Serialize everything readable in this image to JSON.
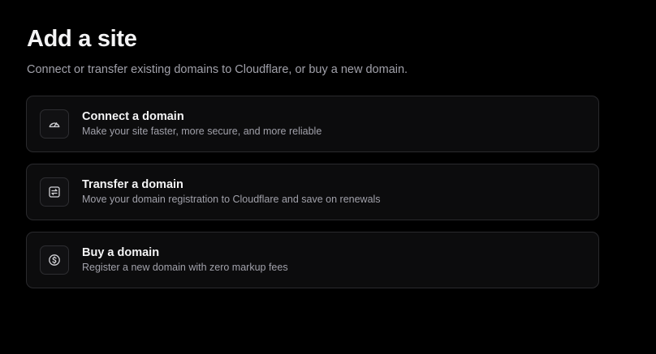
{
  "page": {
    "title": "Add a site",
    "subtitle": "Connect or transfer existing domains to Cloudflare, or buy a new domain."
  },
  "options": [
    {
      "icon": "gauge-icon",
      "title": "Connect a domain",
      "description": "Make your site faster, more secure, and more reliable"
    },
    {
      "icon": "transfer-icon",
      "title": "Transfer a domain",
      "description": "Move your domain registration to Cloudflare and save on renewals"
    },
    {
      "icon": "dollar-circle-icon",
      "title": "Buy a domain",
      "description": "Register a new domain with zero markup fees"
    }
  ],
  "colors": {
    "background": "#000000",
    "card_background": "#0c0c0d",
    "card_border": "#2a2a2d",
    "text_primary": "#f4f4f5",
    "text_secondary": "#a1a1aa"
  }
}
